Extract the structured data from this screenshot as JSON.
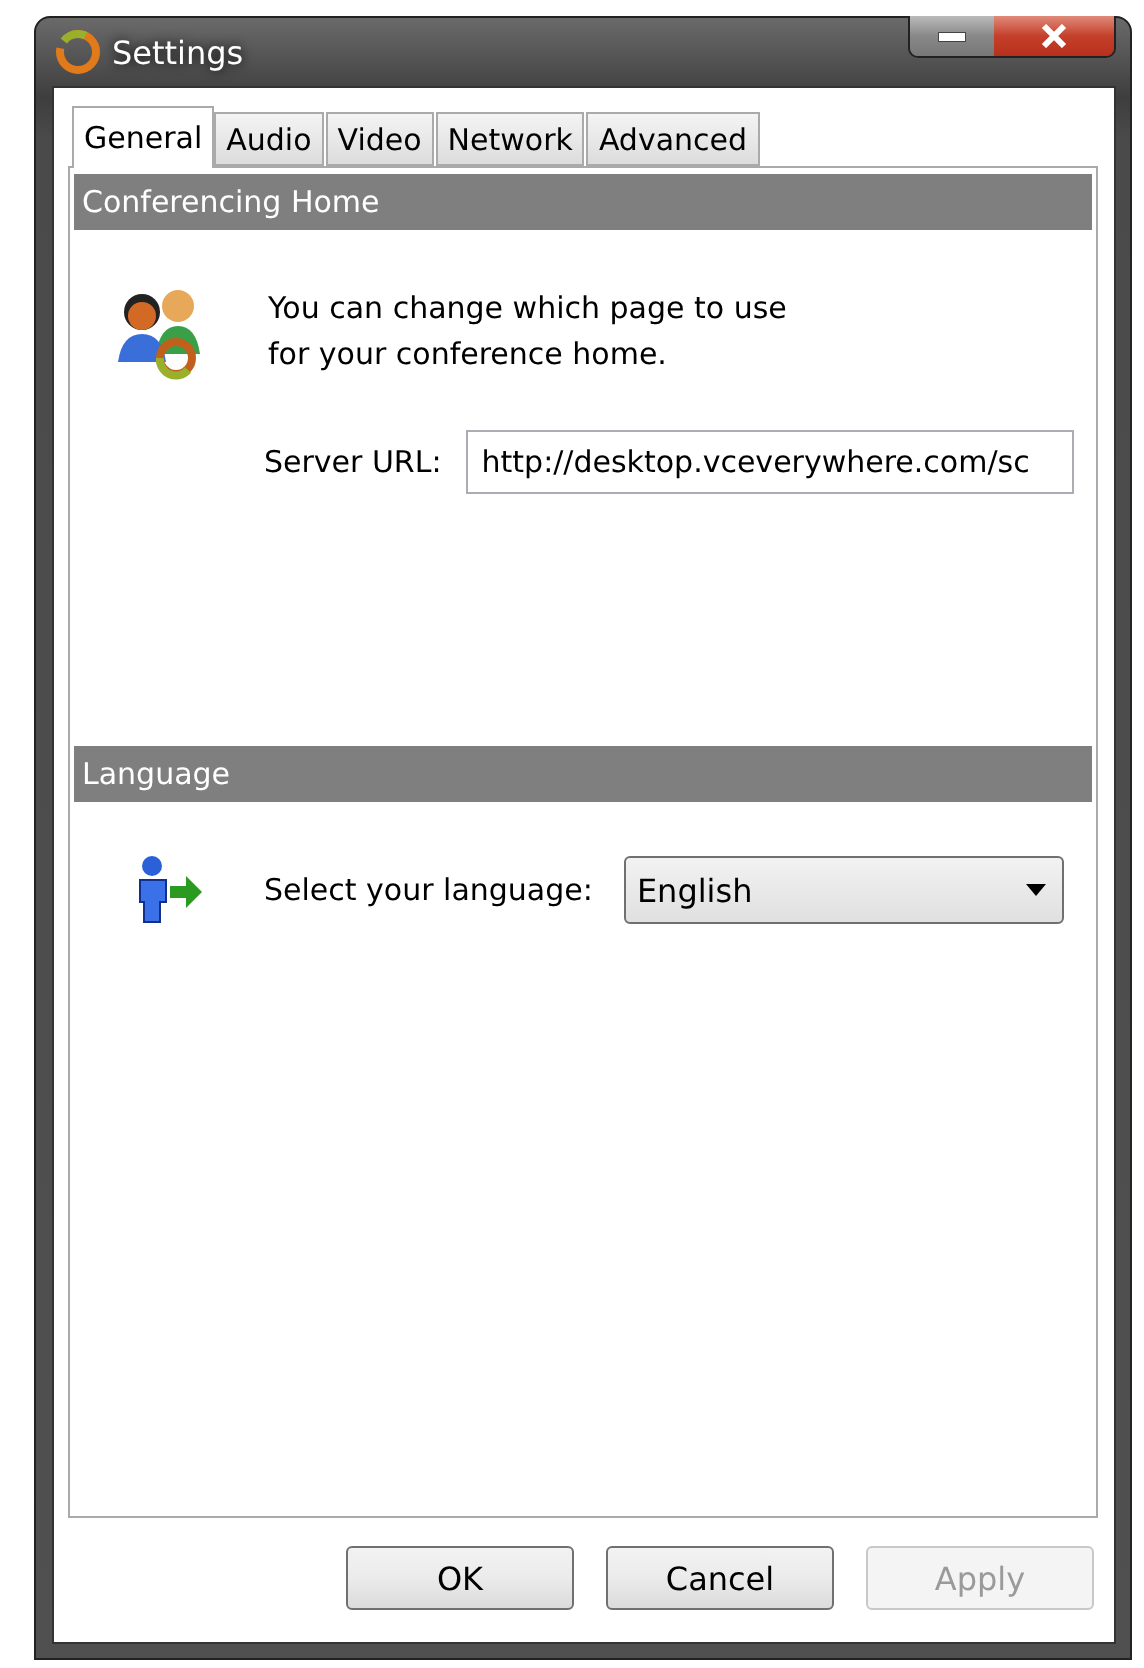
{
  "window": {
    "title": "Settings"
  },
  "tabs": [
    {
      "label": "General",
      "selected": true
    },
    {
      "label": "Audio",
      "selected": false
    },
    {
      "label": "Video",
      "selected": false
    },
    {
      "label": "Network",
      "selected": false
    },
    {
      "label": "Advanced",
      "selected": false
    }
  ],
  "conferencing_home": {
    "header": "Conferencing Home",
    "description": "You can change which page to use\nfor your conference home.",
    "server_url_label": "Server URL:",
    "server_url": "http://desktop.vceverywhere.com/sc"
  },
  "language": {
    "header": "Language",
    "label": "Select your language:",
    "value": "English"
  },
  "buttons": [
    {
      "label": "OK",
      "disabled": false
    },
    {
      "label": "Cancel",
      "disabled": false
    },
    {
      "label": "Apply",
      "disabled": true
    }
  ]
}
